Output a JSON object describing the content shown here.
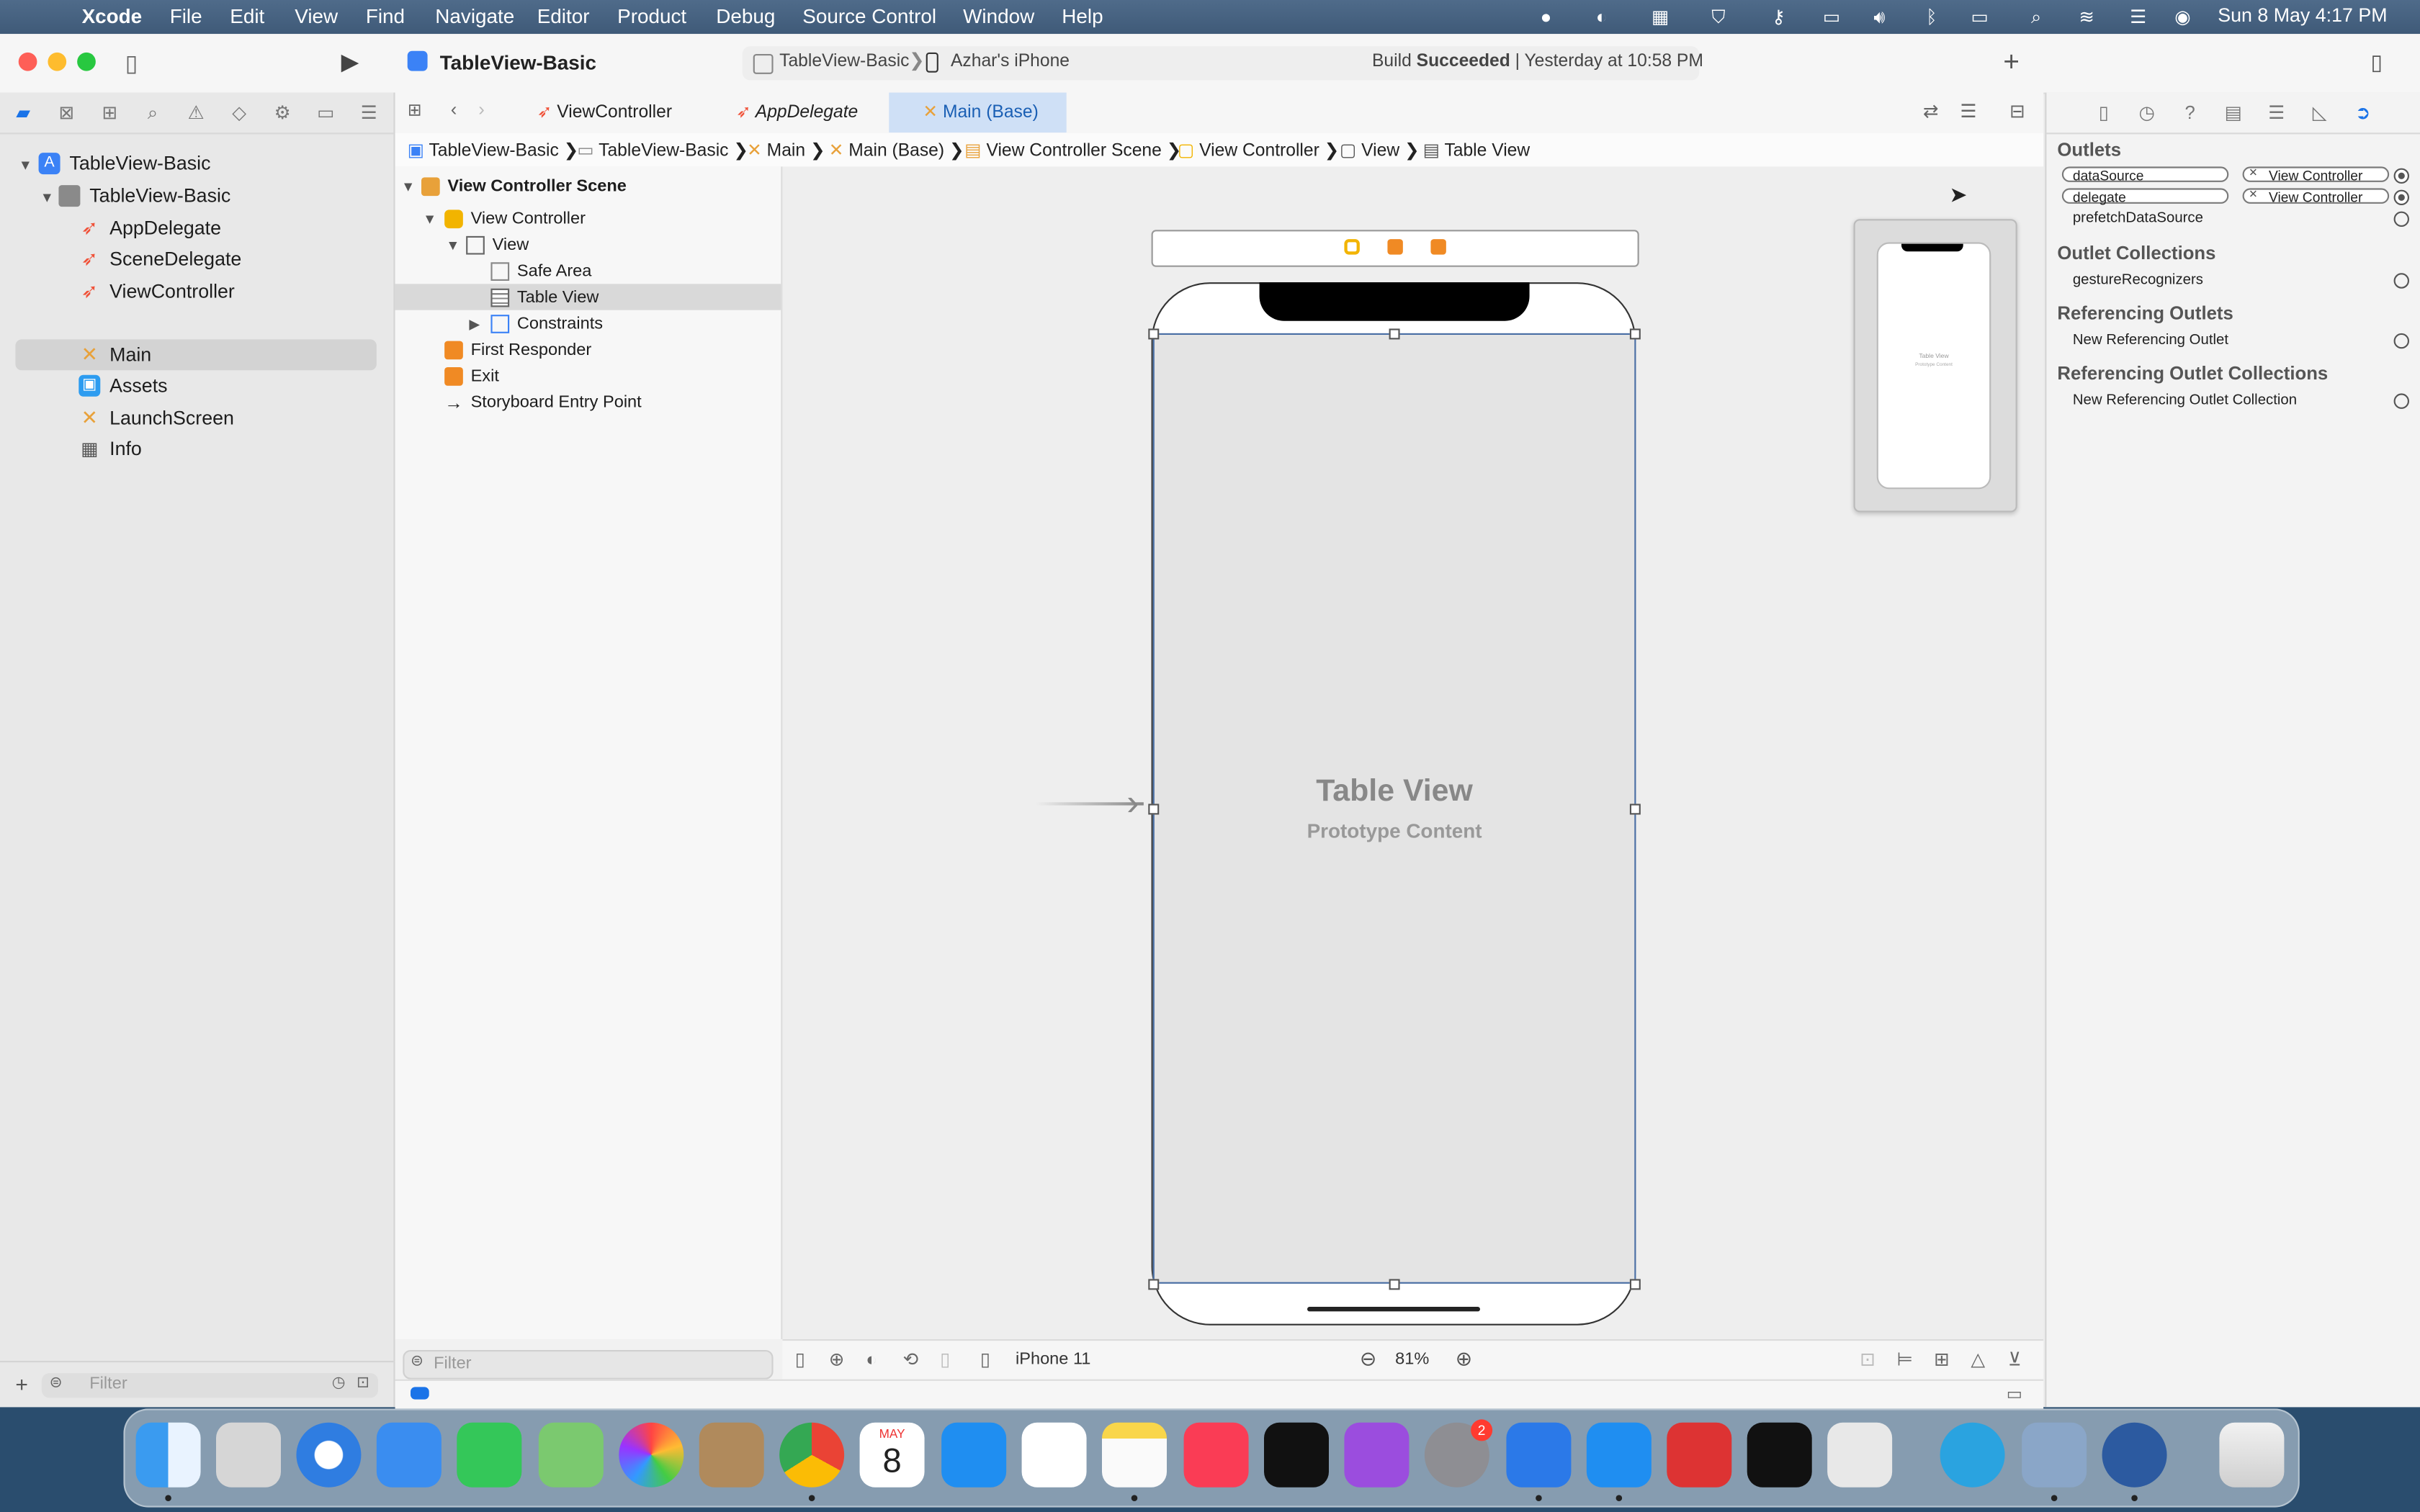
{
  "menubar": {
    "app": "Xcode",
    "items": [
      "File",
      "Edit",
      "View",
      "Find",
      "Navigate",
      "Editor",
      "Product",
      "Debug",
      "Source Control",
      "Window",
      "Help"
    ],
    "clock": "Sun 8 May  4:17 PM"
  },
  "toolbar": {
    "project": "TableView-Basic",
    "scheme": "TableView-Basic",
    "device": "Azhar's iPhone",
    "status_prefix": "Build",
    "status_strong": "Succeeded",
    "status_suffix": "| Yesterday at 10:58 PM"
  },
  "navigator": {
    "items": [
      {
        "label": "TableView-Basic",
        "icon": "project-icon"
      },
      {
        "label": "TableView-Basic",
        "icon": "folder-icon"
      },
      {
        "label": "AppDelegate",
        "icon": "swift-file-icon"
      },
      {
        "label": "SceneDelegate",
        "icon": "swift-file-icon"
      },
      {
        "label": "ViewController",
        "icon": "swift-file-icon"
      },
      {
        "label": "Main",
        "icon": "storyboard-icon"
      },
      {
        "label": "Assets",
        "icon": "asset-catalog-icon"
      },
      {
        "label": "LaunchScreen",
        "icon": "storyboard-icon"
      },
      {
        "label": "Info",
        "icon": "plist-icon"
      }
    ],
    "filter_placeholder": "Filter"
  },
  "editor": {
    "tabs": [
      "ViewController",
      "AppDelegate",
      "Main (Base)"
    ],
    "breadcrumbs": [
      "TableView-Basic",
      "TableView-Basic",
      "Main",
      "Main (Base)",
      "View Controller Scene",
      "View Controller",
      "View",
      "Table View"
    ],
    "outline": {
      "scene": "View Controller Scene",
      "items": [
        "View Controller",
        "View",
        "Safe Area",
        "Table View",
        "Constraints",
        "First Responder",
        "Exit",
        "Storyboard Entry Point"
      ],
      "filter_placeholder": "Filter"
    },
    "canvas": {
      "table_title": "Table View",
      "table_subtitle": "Prototype Content",
      "device": "iPhone 11",
      "zoom": "81%",
      "minimap_title": "Table View",
      "minimap_subtitle": "Prototype Content"
    }
  },
  "inspector": {
    "outlets_header": "Outlets",
    "outlets": [
      {
        "name": "dataSource",
        "target": "View Controller"
      },
      {
        "name": "delegate",
        "target": "View Controller"
      },
      {
        "name": "prefetchDataSource",
        "target": ""
      }
    ],
    "collections_header": "Outlet Collections",
    "collections": [
      "gestureRecognizers"
    ],
    "ref_header": "Referencing Outlets",
    "ref_items": [
      "New Referencing Outlet"
    ],
    "ref_coll_header": "Referencing Outlet Collections",
    "ref_coll_items": [
      "New Referencing Outlet Collection"
    ]
  },
  "dock": {
    "settings_badge": "2",
    "calendar_month": "MAY",
    "calendar_day": "8"
  },
  "colors": {
    "accent": "#1a73e8",
    "swift": "#f05138",
    "storyboard": "#e8a13a",
    "selection": "#d3d3d3"
  }
}
